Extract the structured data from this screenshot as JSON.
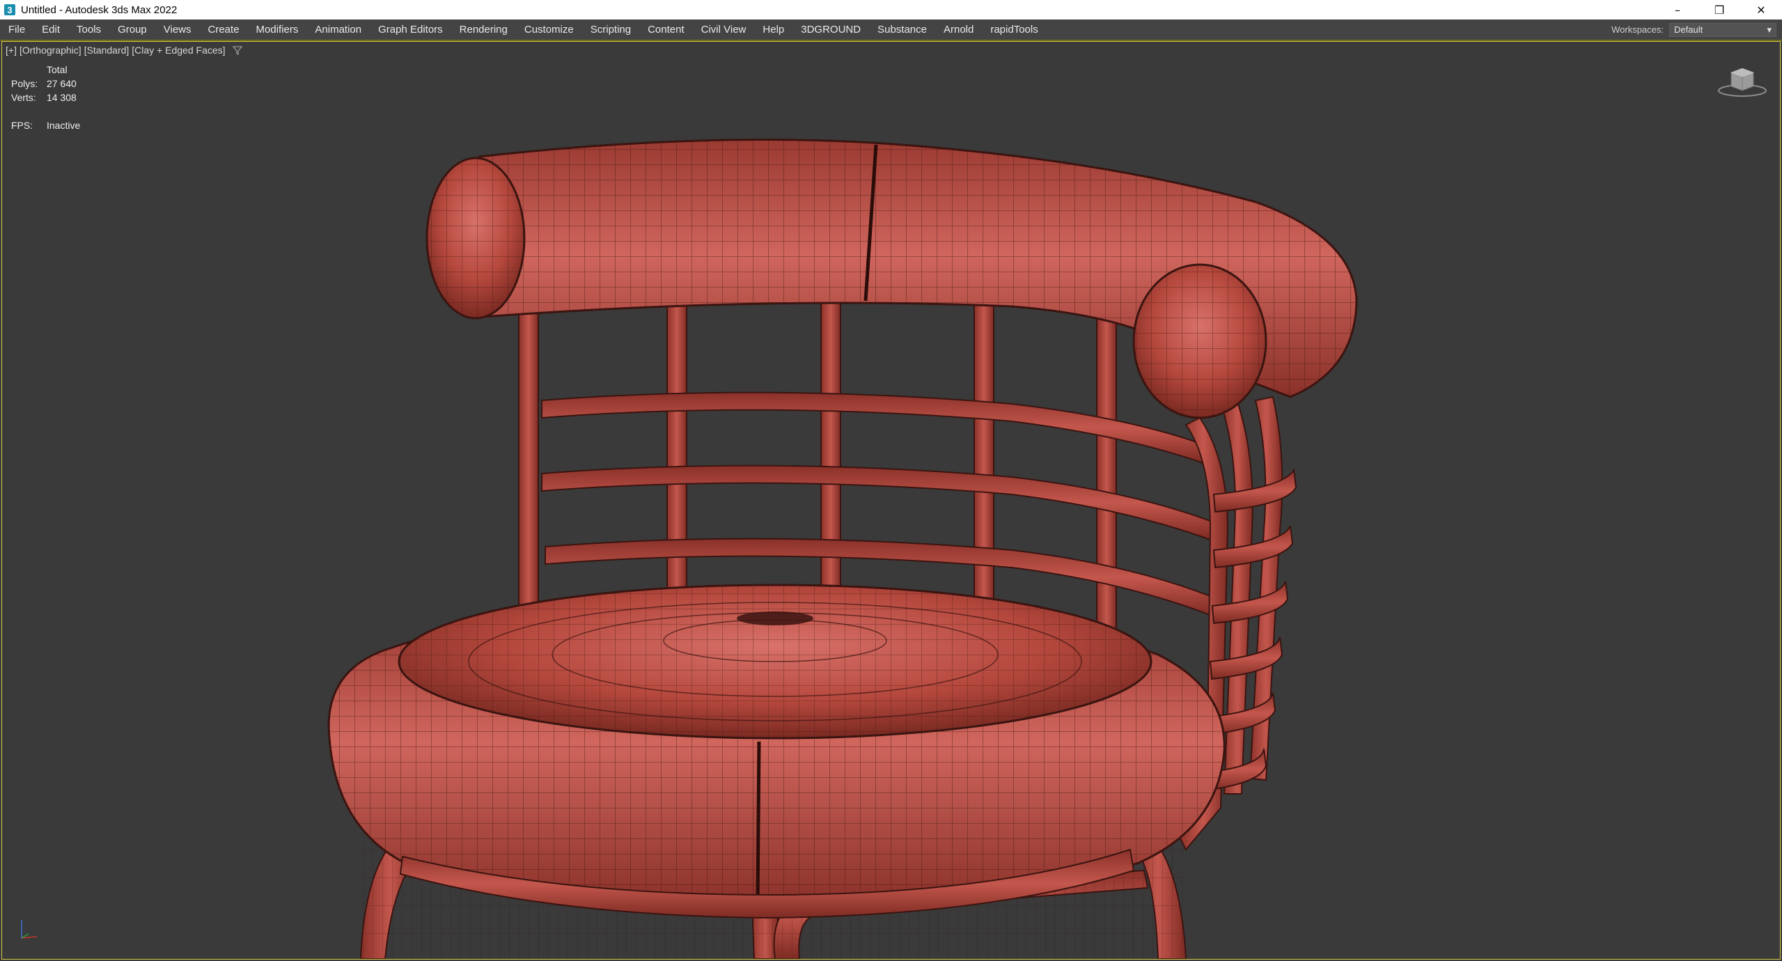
{
  "window": {
    "title": "Untitled - Autodesk 3ds Max 2022",
    "app_icon_glyph": "3",
    "controls": {
      "minimize_glyph": "–",
      "restore_glyph": "❐",
      "close_glyph": "✕"
    }
  },
  "menubar": {
    "items": [
      {
        "label": "File"
      },
      {
        "label": "Edit"
      },
      {
        "label": "Tools"
      },
      {
        "label": "Group"
      },
      {
        "label": "Views"
      },
      {
        "label": "Create"
      },
      {
        "label": "Modifiers"
      },
      {
        "label": "Animation"
      },
      {
        "label": "Graph Editors"
      },
      {
        "label": "Rendering"
      },
      {
        "label": "Customize"
      },
      {
        "label": "Scripting"
      },
      {
        "label": "Content"
      },
      {
        "label": "Civil View"
      },
      {
        "label": "Help"
      },
      {
        "label": "3DGROUND"
      },
      {
        "label": "Substance"
      },
      {
        "label": "Arnold"
      },
      {
        "label": "rapidTools"
      }
    ],
    "workspaces_label": "Workspaces:",
    "workspaces_value": "Default",
    "dropdown_glyph": "▾"
  },
  "viewport": {
    "label_parts": [
      "[+]",
      "[Orthographic]",
      "[Standard]",
      "[Clay + Edged Faces]"
    ],
    "stats": {
      "header": "Total",
      "polys_label": "Polys:",
      "polys_value": "27 640",
      "verts_label": "Verts:",
      "verts_value": "14 308",
      "fps_label": "FPS:",
      "fps_value": "Inactive"
    },
    "colors": {
      "background": "#3a3a3a",
      "model_clay": "#b5483d",
      "wire": "#3b1410",
      "active_border": "#d4c94a"
    },
    "icons": [
      "filter-icon",
      "viewcube-icon",
      "axis-tripod-icon"
    ]
  }
}
